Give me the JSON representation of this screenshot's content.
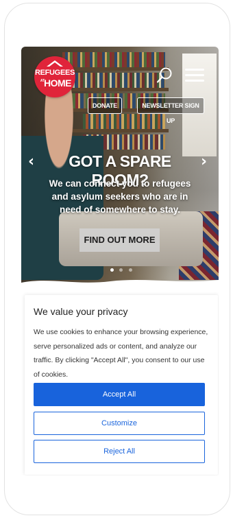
{
  "brand": {
    "logo_line1": "REFUGEES",
    "logo_at": "AT",
    "logo_line2": "HOME",
    "primary_color": "#e0243a"
  },
  "header": {
    "search_icon": "search-icon",
    "menu_icon": "hamburger-menu-icon",
    "donate_label": "DONATE",
    "newsletter_label": "NEWSLETTER SIGN UP"
  },
  "hero": {
    "prev_arrow": "‹",
    "next_arrow": "›",
    "headline": "GOT A SPARE ROOM?",
    "subtext": "We can connect you to refugees and asylum seekers who are in need of somewhere to stay.",
    "cta_label": "FIND OUT MORE",
    "slide_count": 3,
    "active_slide": 1
  },
  "cookie_banner": {
    "title": "We value your privacy",
    "text": "We use cookies to enhance your browsing experience, serve personalized ads or content, and analyze our traffic. By clicking \"Accept All\", you consent to our use of cookies.",
    "accept_label": "Accept All",
    "customize_label": "Customize",
    "reject_label": "Reject All",
    "accent_color": "#1863dc"
  }
}
